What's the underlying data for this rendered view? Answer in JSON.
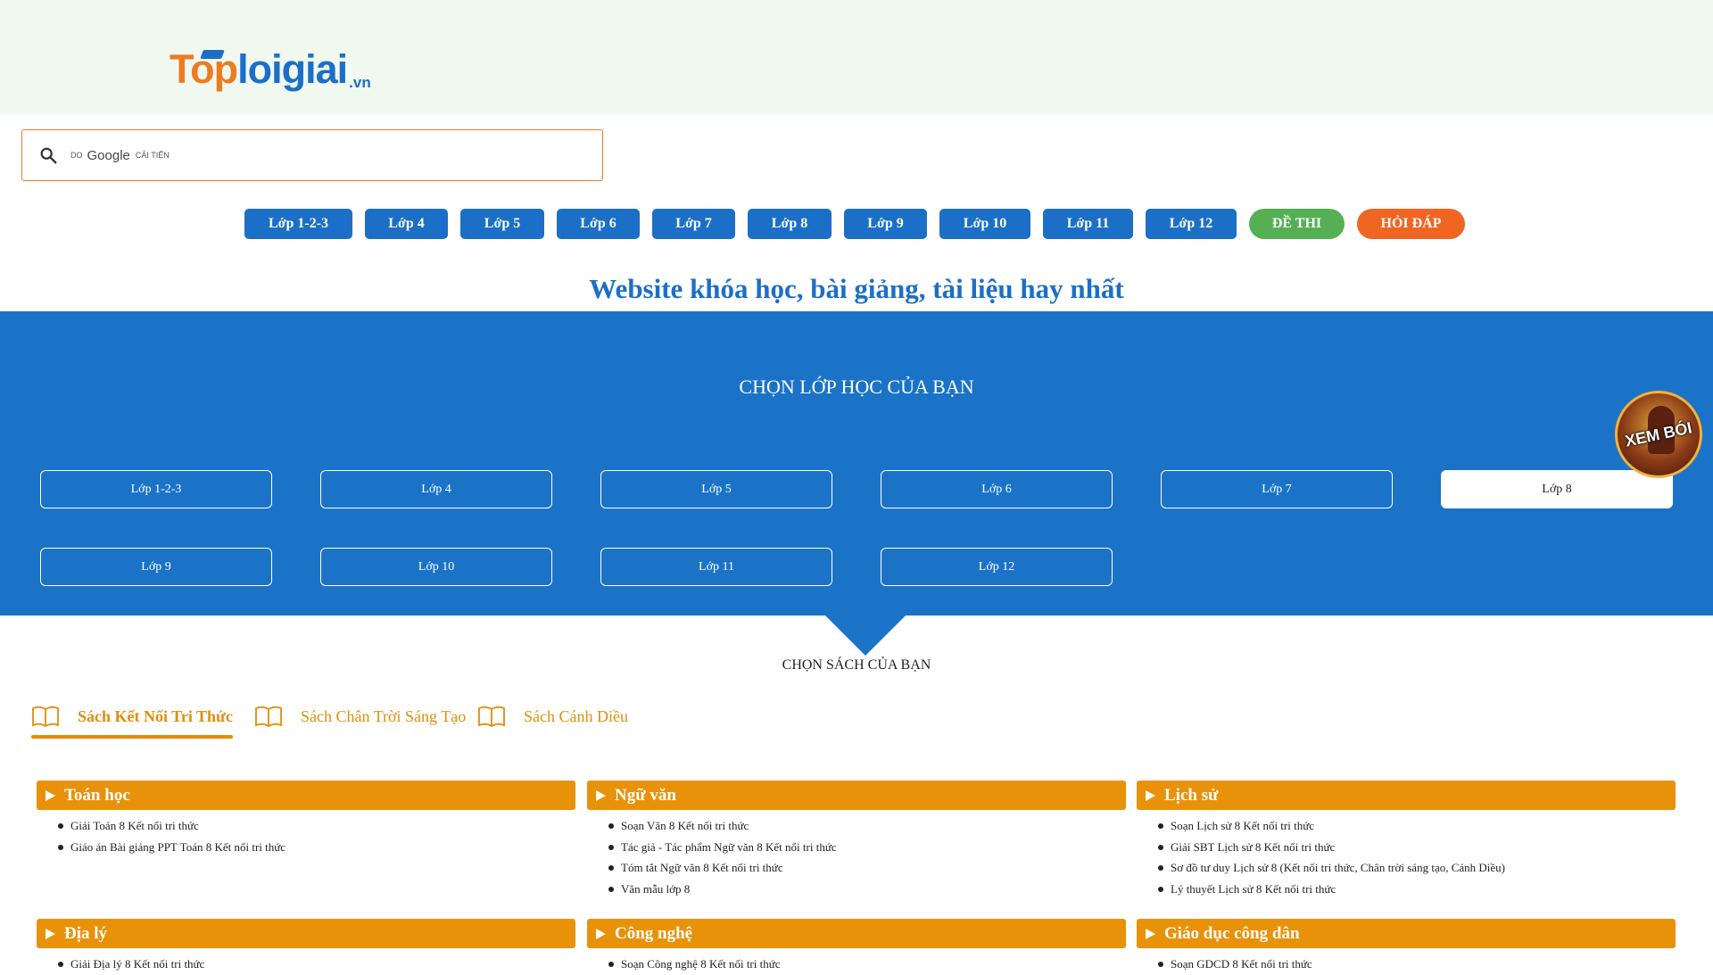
{
  "logo": {
    "top": "To",
    "p": "p",
    "rest": "loigiai",
    "domain": ".vn"
  },
  "search": {
    "by": "DO",
    "brand": "Google",
    "enhanced": "CẢI TIẾN",
    "value": ""
  },
  "nav": [
    {
      "label": "Lớp 1-2-3"
    },
    {
      "label": "Lớp 4"
    },
    {
      "label": "Lớp 5"
    },
    {
      "label": "Lớp 6"
    },
    {
      "label": "Lớp 7"
    },
    {
      "label": "Lớp 8"
    },
    {
      "label": "Lớp 9"
    },
    {
      "label": "Lớp 10"
    },
    {
      "label": "Lớp 11"
    },
    {
      "label": "Lớp 12"
    },
    {
      "label": "ĐỀ THI"
    },
    {
      "label": "HỎI ĐÁP"
    }
  ],
  "headline": "Website khóa học, bài giảng, tài liệu hay nhất",
  "class_section": {
    "title": "CHỌN LỚP HỌC CỦA BẠN",
    "grades": [
      "Lớp 1-2-3",
      "Lớp 4",
      "Lớp 5",
      "Lớp 6",
      "Lớp 7",
      "Lớp 8",
      "Lớp 9",
      "Lớp 10",
      "Lớp 11",
      "Lớp 12"
    ],
    "selected": "Lớp 8"
  },
  "badge": {
    "label": "XEM BÓI"
  },
  "book_section": {
    "title": "CHỌN SÁCH CỦA BẠN",
    "tabs": [
      "Sách Kết Nối Tri Thức",
      "Sách Chân Trời Sáng Tạo",
      "Sách Cánh Diều"
    ],
    "active": "Sách Kết Nối Tri Thức"
  },
  "subjects": [
    {
      "title": "Toán học",
      "items": [
        "Giải Toán 8 Kết nối tri thức",
        "Giáo án Bài giảng PPT Toán 8 Kết nối tri thức"
      ]
    },
    {
      "title": "Ngữ văn",
      "items": [
        "Soạn Văn 8 Kết nối tri thức",
        "Tác giả - Tác phẩm Ngữ văn 8 Kết nối tri thức",
        "Tóm tắt Ngữ văn 8 Kết nối tri thức",
        "Văn mẫu lớp 8"
      ]
    },
    {
      "title": "Lịch sử",
      "items": [
        "Soạn Lịch sử 8 Kết nối tri thức",
        "Giải SBT Lịch sử 8 Kết nối tri thức",
        "Sơ đồ tư duy Lịch sử 8 (Kết nối tri thức, Chân trời sáng tạo, Cánh Diều)",
        "Lý thuyết Lịch sử 8 Kết nối tri thức"
      ]
    },
    {
      "title": "Địa lý",
      "items": [
        "Giải Địa lý 8 Kết nối tri thức"
      ]
    },
    {
      "title": "Công nghệ",
      "items": [
        "Soạn Công nghệ 8 Kết nối tri thức"
      ]
    },
    {
      "title": "Giáo dục công dân",
      "items": [
        "Soạn GDCD 8 Kết nối tri thức"
      ]
    }
  ],
  "colors": {
    "brand_blue": "#1c6fc6",
    "brand_orange": "#ee7b22",
    "section_blue": "#1b73c8",
    "subject_orange": "#e8920a",
    "green": "#55b054"
  },
  "icons": [
    "search-icon",
    "book-icon",
    "triangle-right-icon"
  ]
}
